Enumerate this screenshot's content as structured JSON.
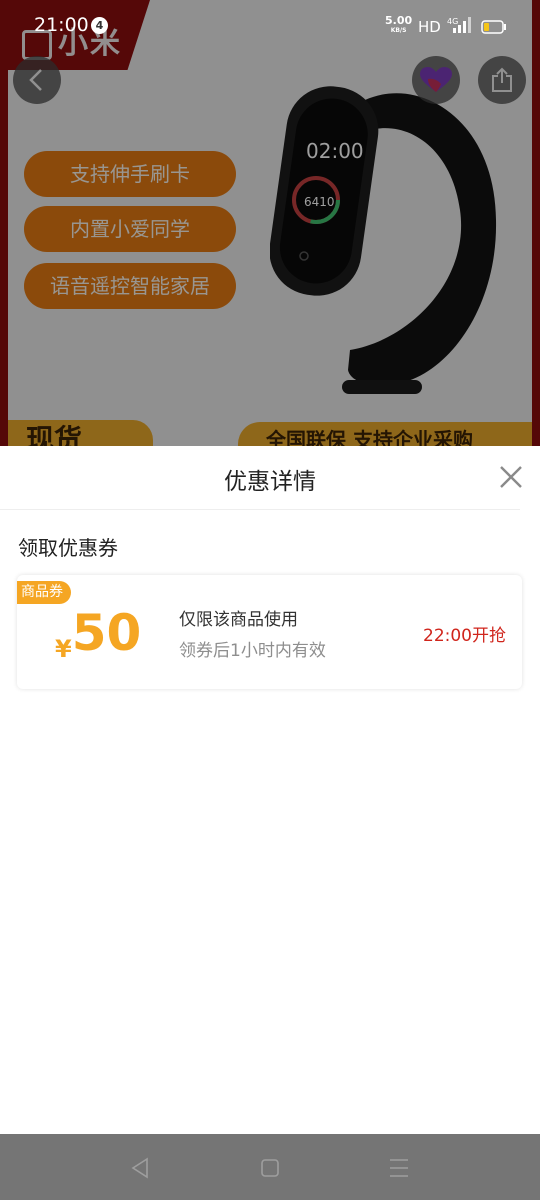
{
  "status_bar": {
    "time": "21:00",
    "notification_count": "4",
    "net_speed": "5.00",
    "net_speed_unit": "KB/S",
    "hd_label": "HD",
    "network_type": "4G"
  },
  "banner": {
    "brand": "小米",
    "features": [
      "支持伸手刷卡",
      "内置小爱同学",
      "语音遥控智能家居"
    ],
    "band_time": "02:00",
    "band_steps": "6410",
    "partial_left": "现货",
    "partial_right": "全国联保 支持企业采购"
  },
  "sheet": {
    "title": "优惠详情",
    "section_label": "领取优惠券",
    "coupon": {
      "tag": "商品券",
      "currency": "¥",
      "amount": "50",
      "description": "仅限该商品使用",
      "validity": "领券后1小时内有效",
      "start_time": "22:00开抢"
    }
  },
  "colors": {
    "accent_orange": "#f5a623",
    "alert_red": "#d0251c",
    "banner_pill": "#e07812",
    "brand_red": "#8a0d0d"
  }
}
